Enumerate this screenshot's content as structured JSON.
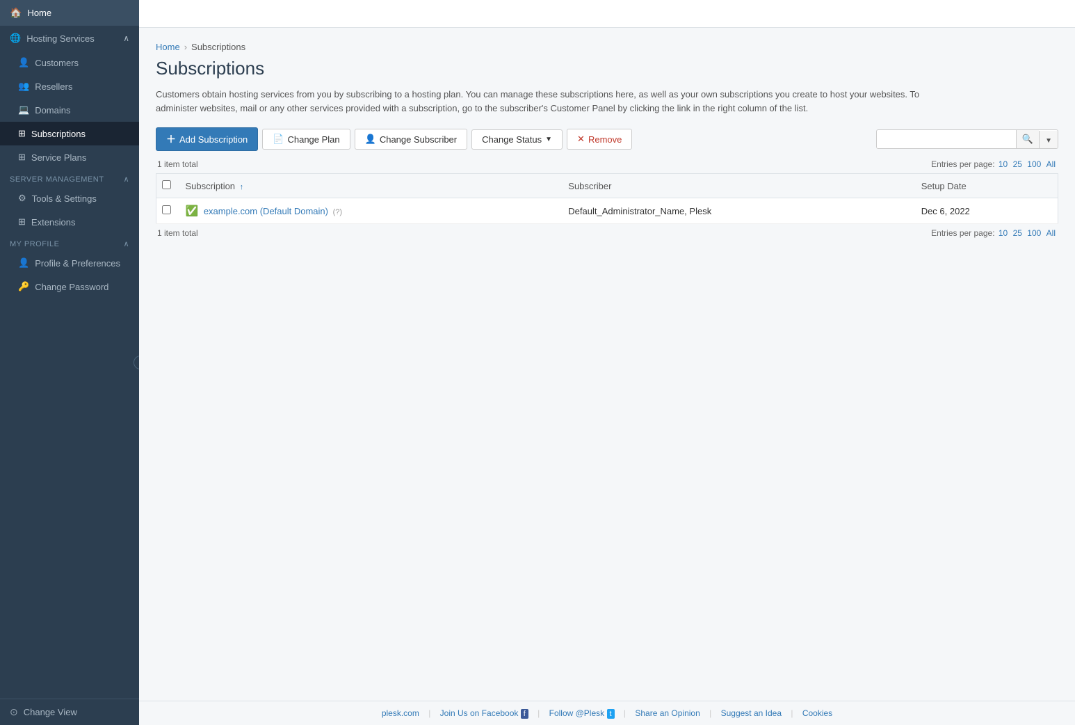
{
  "sidebar": {
    "items": [
      {
        "id": "home",
        "label": "Home",
        "icon": "🏠",
        "level": "top"
      },
      {
        "id": "hosting-services",
        "label": "Hosting Services",
        "icon": "🌐",
        "level": "section",
        "expanded": true
      },
      {
        "id": "customers",
        "label": "Customers",
        "icon": "👤",
        "level": "sub"
      },
      {
        "id": "resellers",
        "label": "Resellers",
        "icon": "👥",
        "level": "sub"
      },
      {
        "id": "domains",
        "label": "Domains",
        "icon": "💻",
        "level": "sub"
      },
      {
        "id": "subscriptions",
        "label": "Subscriptions",
        "icon": "⊞",
        "level": "sub",
        "active": true
      },
      {
        "id": "service-plans",
        "label": "Service Plans",
        "icon": "⊞",
        "level": "sub"
      },
      {
        "id": "server-management",
        "label": "Server Management",
        "icon": "",
        "level": "section",
        "expanded": true
      },
      {
        "id": "tools-settings",
        "label": "Tools & Settings",
        "icon": "⚙",
        "level": "sub"
      },
      {
        "id": "extensions",
        "label": "Extensions",
        "icon": "⊞",
        "level": "sub"
      },
      {
        "id": "my-profile",
        "label": "My Profile",
        "icon": "",
        "level": "section",
        "expanded": true
      },
      {
        "id": "profile-preferences",
        "label": "Profile & Preferences",
        "icon": "👤",
        "level": "sub"
      },
      {
        "id": "change-password",
        "label": "Change Password",
        "icon": "🔑",
        "level": "sub"
      }
    ],
    "change_view_label": "Change View",
    "collapse_icon": "‹"
  },
  "breadcrumb": {
    "home": "Home",
    "current": "Subscriptions"
  },
  "page": {
    "title": "Subscriptions",
    "description": "Customers obtain hosting services from you by subscribing to a hosting plan. You can manage these subscriptions here, as well as your own subscriptions you create to host your websites. To administer websites, mail or any other services provided with a subscription, go to the subscriber's Customer Panel by clicking the link in the right column of the list."
  },
  "toolbar": {
    "add_subscription": "Add Subscription",
    "change_plan": "Change Plan",
    "change_subscriber": "Change Subscriber",
    "change_status": "Change Status",
    "remove": "Remove",
    "search_placeholder": ""
  },
  "table": {
    "item_count": "1 item total",
    "entries_label": "Entries per page:",
    "entries_options": [
      "10",
      "25",
      "100",
      "All"
    ],
    "columns": [
      "Subscription",
      "Subscriber",
      "Setup Date"
    ],
    "rows": [
      {
        "subscription_name": "example.com (Default Domain)",
        "subscription_help": "(?)",
        "subscriber": "Default_Administrator_Name, Plesk",
        "setup_date": "Dec 6, 2022",
        "status": "ok"
      }
    ]
  },
  "footer": {
    "links": [
      {
        "label": "plesk.com",
        "url": "#"
      },
      {
        "label": "Join Us on Facebook",
        "url": "#"
      },
      {
        "label": "Follow @Plesk",
        "url": "#"
      },
      {
        "label": "Share an Opinion",
        "url": "#"
      },
      {
        "label": "Suggest an Idea",
        "url": "#"
      },
      {
        "label": "Cookies",
        "url": "#"
      }
    ]
  }
}
